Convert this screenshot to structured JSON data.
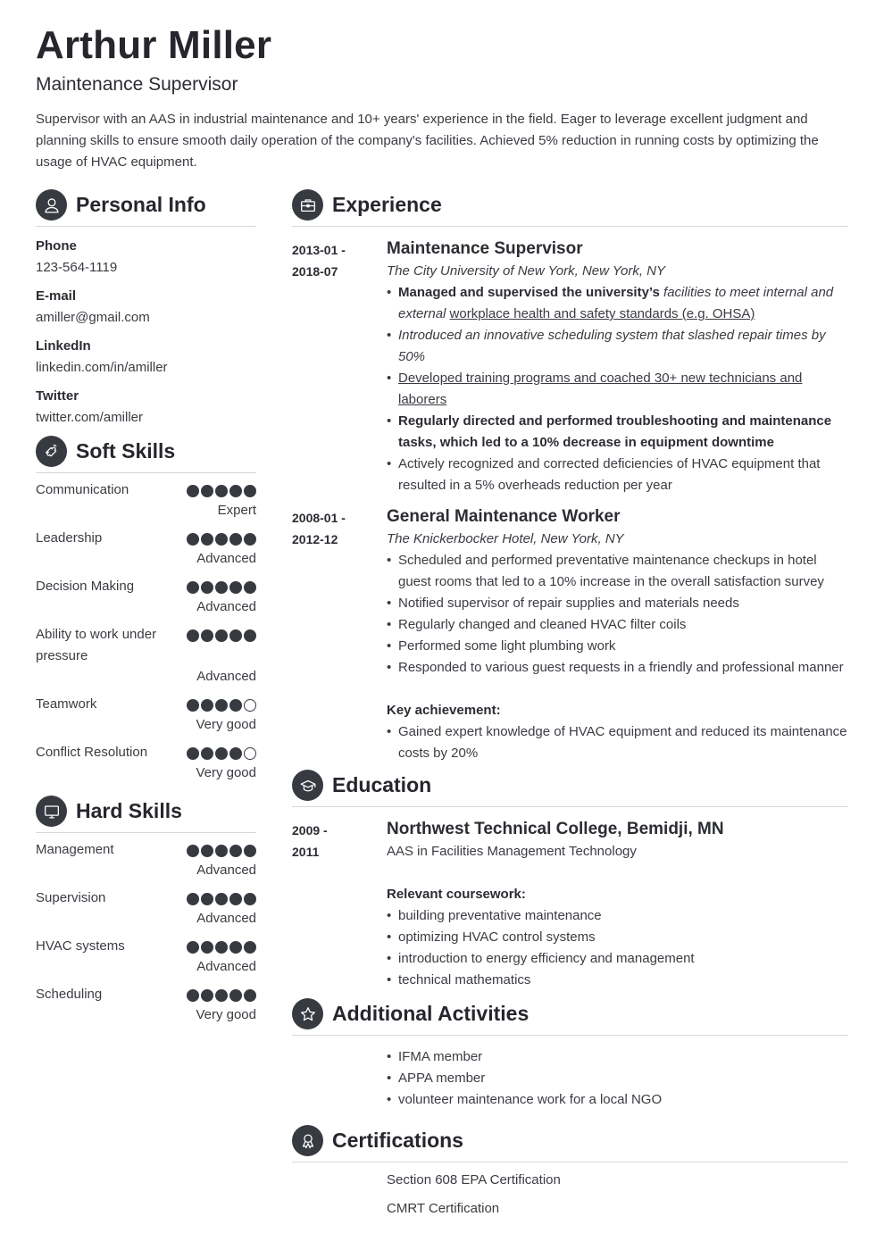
{
  "header": {
    "name": "Arthur Miller",
    "title": "Maintenance Supervisor",
    "summary": "Supervisor with an AAS in industrial maintenance and 10+ years' experience in the field. Eager to leverage excellent judgment and planning skills to ensure smooth daily operation of the company's facilities. Achieved 5% reduction in running costs by optimizing the usage of HVAC equipment."
  },
  "colors": {
    "text": "#2b2d33",
    "icon_bg": "#373a40",
    "divider": "#d7d8da"
  },
  "personal_info": {
    "heading": "Personal Info",
    "icon": "user-icon",
    "items": [
      {
        "label": "Phone",
        "value": "123-564-1119"
      },
      {
        "label": "E-mail",
        "value": "amiller@gmail.com"
      },
      {
        "label": "LinkedIn",
        "value": "linkedin.com/in/amiller"
      },
      {
        "label": "Twitter",
        "value": "twitter.com/amiller"
      }
    ]
  },
  "soft_skills": {
    "heading": "Soft Skills",
    "icon": "puzzle-icon",
    "items": [
      {
        "name": "Communication",
        "level": "Expert",
        "rating": 5,
        "max": 5
      },
      {
        "name": "Leadership",
        "level": "Advanced",
        "rating": 5,
        "max": 5
      },
      {
        "name": "Decision Making",
        "level": "Advanced",
        "rating": 5,
        "max": 5
      },
      {
        "name": "Ability to work under pressure",
        "level": "Advanced",
        "rating": 5,
        "max": 5
      },
      {
        "name": "Teamwork",
        "level": "Very good",
        "rating": 4,
        "max": 5
      },
      {
        "name": "Conflict Resolution",
        "level": "Very good",
        "rating": 4,
        "max": 5
      }
    ]
  },
  "hard_skills": {
    "heading": "Hard Skills",
    "icon": "monitor-icon",
    "items": [
      {
        "name": "Management",
        "level": "Advanced",
        "rating": 5,
        "max": 5
      },
      {
        "name": "Supervision",
        "level": "Advanced",
        "rating": 5,
        "max": 5
      },
      {
        "name": "HVAC systems",
        "level": "Advanced",
        "rating": 5,
        "max": 5
      },
      {
        "name": "Scheduling",
        "level": "Very good",
        "rating": 5,
        "max": 5
      }
    ]
  },
  "experience": {
    "heading": "Experience",
    "icon": "briefcase-icon",
    "jobs": [
      {
        "date_start": "2013-01 -",
        "date_end": "2018-07",
        "title": "Maintenance Supervisor",
        "company": "The City University of New York, New York, NY",
        "bullets": [
          {
            "parts": [
              {
                "text": "Managed and supervised the university’s ",
                "style": "b"
              },
              {
                "text": "facilities to meet internal and external",
                "style": "i"
              },
              {
                "text": " ",
                "style": ""
              },
              {
                "text": "workplace health and safety standards (e.g. OHSA)",
                "style": "u"
              }
            ]
          },
          {
            "parts": [
              {
                "text": "Introduced an innovative scheduling system that slashed repair times by 50%",
                "style": "i"
              }
            ]
          },
          {
            "parts": [
              {
                "text": "Developed training programs and coached 30+ new technicians and laborers",
                "style": "u"
              }
            ]
          },
          {
            "parts": [
              {
                "text": "Regularly directed and performed troubleshooting and maintenance tasks, which led to a 10% decrease in equipment downtime",
                "style": "b"
              }
            ]
          },
          {
            "parts": [
              {
                "text": "Actively recognized and corrected deficiencies of HVAC equipment that resulted in a 5% overheads reduction per year",
                "style": ""
              }
            ]
          }
        ]
      },
      {
        "date_start": "2008-01 -",
        "date_end": "2012-12",
        "title": "General Maintenance Worker",
        "company": "The Knickerbocker Hotel, New York, NY",
        "bullets": [
          "Scheduled and performed preventative maintenance checkups in hotel guest rooms that led to a 10% increase in the overall satisfaction survey",
          "Notified supervisor of repair supplies and materials needs",
          "Regularly changed and cleaned HVAC filter coils",
          "Performed some light plumbing work",
          "Responded to various guest requests in a friendly and professional manner"
        ],
        "key_achievement_label": "Key achievement:",
        "key_achievements": [
          "Gained expert knowledge of HVAC equipment and reduced its maintenance costs by 20%"
        ]
      }
    ]
  },
  "education": {
    "heading": "Education",
    "icon": "graduation-cap-icon",
    "items": [
      {
        "date_start": "2009 -",
        "date_end": "2011",
        "school": "Northwest Technical College, Bemidji, MN",
        "degree": "AAS in Facilities Management Technology",
        "coursework_label": "Relevant coursework:",
        "coursework": [
          "building preventative maintenance",
          "optimizing HVAC control systems",
          "introduction to energy efficiency and management",
          "technical mathematics"
        ]
      }
    ]
  },
  "activities": {
    "heading": "Additional Activities",
    "icon": "star-icon",
    "items": [
      "IFMA member",
      "APPA member",
      "volunteer maintenance work for a local NGO"
    ]
  },
  "certifications": {
    "heading": "Certifications",
    "icon": "award-ribbon-icon",
    "items": [
      "Section 608 EPA Certification",
      "CMRT Certification"
    ]
  }
}
